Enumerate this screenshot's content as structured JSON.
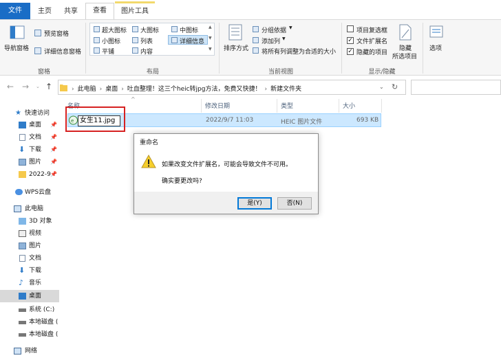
{
  "ribbon_tabs": {
    "file": "文件",
    "home": "主页",
    "share": "共享",
    "view": "查看",
    "picture_tools": "图片工具"
  },
  "ribbon": {
    "panes": {
      "nav_pane": "导航窗格",
      "preview_pane": "预览窗格",
      "details_pane": "详细信息窗格",
      "group_label": "窗格"
    },
    "layout": {
      "extra_large": "超大图标",
      "large": "大图标",
      "medium": "中图标",
      "small": "小图标",
      "list": "列表",
      "details": "详细信息",
      "tiles": "平铺",
      "content": "内容",
      "group_label": "布局"
    },
    "current_view": {
      "sort_by": "排序方式",
      "group_by": "分组依据",
      "add_columns": "添加列",
      "size_columns": "将所有列调整为合适的大小",
      "group_label": "当前视图"
    },
    "show_hide": {
      "item_checkboxes": "项目复选框",
      "file_extensions": "文件扩展名",
      "hidden_items": "隐藏的项目",
      "hide_selected_1": "隐藏",
      "hide_selected_2": "所选项目",
      "group_label": "显示/隐藏",
      "item_checkboxes_checked": false,
      "file_extensions_checked": true,
      "hidden_items_checked": true
    },
    "options": "选项"
  },
  "address": {
    "crumbs": [
      "此电脑",
      "桌面",
      "吐血整理！这三个heic转jpg方法，免费又快捷！",
      "新建文件夹"
    ]
  },
  "nav_pane": {
    "quick_access": "快速访问",
    "desktop": "桌面",
    "documents": "文档",
    "downloads": "下载",
    "pictures": "图片",
    "folder_2022": "2022-9",
    "wps": "WPS云盘",
    "this_pc": "此电脑",
    "objects3d": "3D 对象",
    "videos": "视频",
    "pictures2": "图片",
    "documents2": "文档",
    "downloads2": "下载",
    "music": "音乐",
    "desktop2": "桌面",
    "system_c": "系统 (C:)",
    "local_disk1": "本地磁盘 (",
    "local_disk2": "本地磁盘 (",
    "network": "网络"
  },
  "file_list": {
    "columns": {
      "name": "名称",
      "date": "修改日期",
      "type": "类型",
      "size": "大小"
    },
    "rows": [
      {
        "name": "女生11.jpg",
        "date": "2022/9/7 11:03",
        "type": "HEIC 图片文件",
        "size": "693 KB"
      }
    ]
  },
  "dialog": {
    "title": "重命名",
    "message": "如果改变文件扩展名，可能会导致文件不可用。",
    "question": "确实要更改吗?",
    "yes": "是(Y)",
    "no": "否(N)"
  },
  "colors": {
    "file_tab": "#1a6dc6",
    "selection": "#cce8ff",
    "highlight_box": "#d62020",
    "default_button_border": "#0078d7"
  }
}
